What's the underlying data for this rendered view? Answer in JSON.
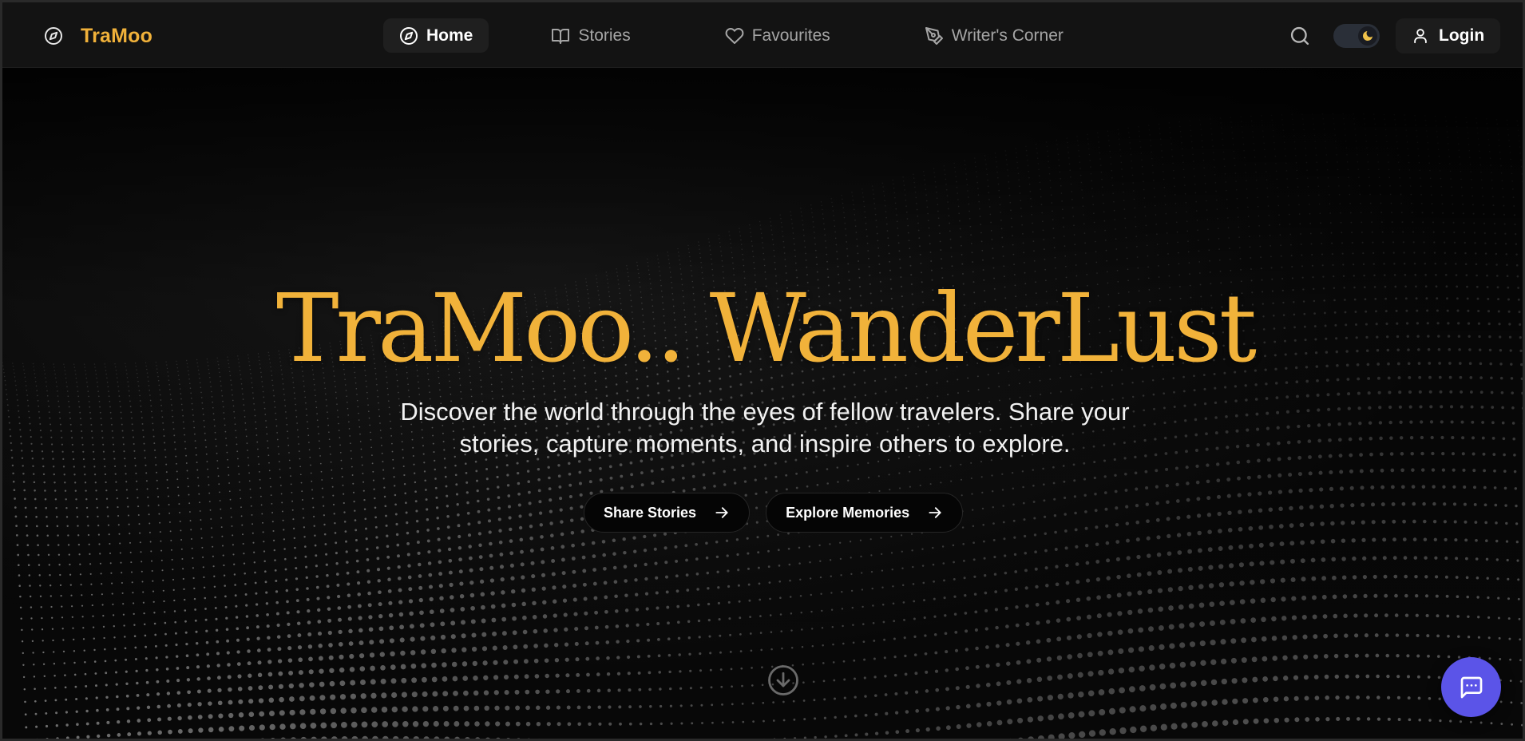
{
  "brand": {
    "name": "TraMoo",
    "icon": "compass-icon",
    "accent_color": "#f0b13a"
  },
  "nav": {
    "items": [
      {
        "label": "Home",
        "icon": "compass-icon",
        "active": true
      },
      {
        "label": "Stories",
        "icon": "book-open-icon",
        "active": false
      },
      {
        "label": "Favourites",
        "icon": "heart-icon",
        "active": false
      },
      {
        "label": "Writer's Corner",
        "icon": "pen-tool-icon",
        "active": false
      }
    ]
  },
  "header_actions": {
    "search_icon": "search-icon",
    "theme_toggle": {
      "mode": "dark",
      "icon": "moon-icon"
    },
    "login_label": "Login",
    "login_icon": "user-icon"
  },
  "hero": {
    "title": "TraMoo.. WanderLust",
    "subtitle": "Discover the world through the eyes of fellow travelers. Share your stories, capture moments, and inspire others to explore.",
    "buttons": [
      {
        "label": "Share Stories",
        "icon": "arrow-right-icon"
      },
      {
        "label": "Explore Memories",
        "icon": "arrow-right-icon"
      }
    ],
    "scroll_icon": "arrow-down-circle-icon"
  },
  "chat": {
    "icon": "message-square-icon",
    "color": "#5b54e8"
  }
}
